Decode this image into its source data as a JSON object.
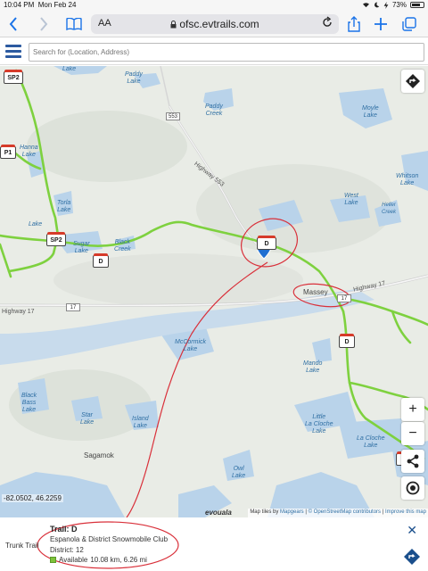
{
  "status_bar": {
    "time": "10:04 PM",
    "date": "Mon Feb 24",
    "battery": "73%",
    "battery_level": 0.73
  },
  "browser": {
    "text_size_label": "AA",
    "url": "ofsc.evtrails.com",
    "icons": [
      "back-icon",
      "forward-icon",
      "bookmarks-icon",
      "lock-icon",
      "reload-icon",
      "share-icon",
      "new-tab-icon",
      "tabs-icon"
    ]
  },
  "app": {
    "search_placeholder": "Search for (Location, Address)"
  },
  "map": {
    "water_labels": {
      "paddy_lake": "Paddy\nLake",
      "paddy_creek": "Paddy\nCreek",
      "moyle_lake": "Moyle\nLake",
      "hanna_lake": "Hanna\nLake",
      "whitson_lake": "Whitson\nLake",
      "torla_lake": "Torla\nLake",
      "west_lake": "West\nLake",
      "heller_creek": "Heller\nCreek",
      "sugar_lake": "Sugar\nLake",
      "black_creek": "Black\nCreek",
      "mccormick_lake": "McCormick\nLake",
      "mando_lake": "Mando\nLake",
      "black_bass_lake": "Black\nBass\nLake",
      "star_lake": "Star\nLake",
      "island_lake": "Island\nLake",
      "little_la_cloche_lake": "Little\nLa Cloche\nLake",
      "la_cloche_lake": "La Cloche\nLake",
      "owl_lake": "Owl\nLake",
      "lake_top_left": "Lake",
      "lake_top_mid": "Lake"
    },
    "place_labels": {
      "massey": "Massey",
      "sagamok": "Sagamok"
    },
    "road_labels": {
      "highway_553": "Highway 553",
      "highway_17_west": "Highway 17",
      "highway_17_east": "Highway 17"
    },
    "road_shields": [
      "553",
      "17",
      "17"
    ],
    "trail_shields": [
      "SP2",
      "SP2",
      "D",
      "D",
      "P1",
      "D",
      "D"
    ],
    "coordinates": "-82.0502, 46.2259",
    "attribution": {
      "brand": "evouala",
      "tiles_by": "Map tiles by",
      "mapgears": "Mapgears",
      "osm": "© OpenStreetMap contributors",
      "improve": "Improve this map"
    },
    "colors": {
      "trail": "#7ed13f",
      "water": "#b9d3ea",
      "land": "#e9ece6",
      "annotation": "#d9303a",
      "marker": "#1f6fd1"
    }
  },
  "trail_panel": {
    "type_label": "Trunk Trail",
    "title": "Trail: D",
    "club": "Espanola & District Snowmobile Club",
    "district": "District: 12",
    "status": "Available",
    "length": "10.08 km, 6.26 mi"
  }
}
